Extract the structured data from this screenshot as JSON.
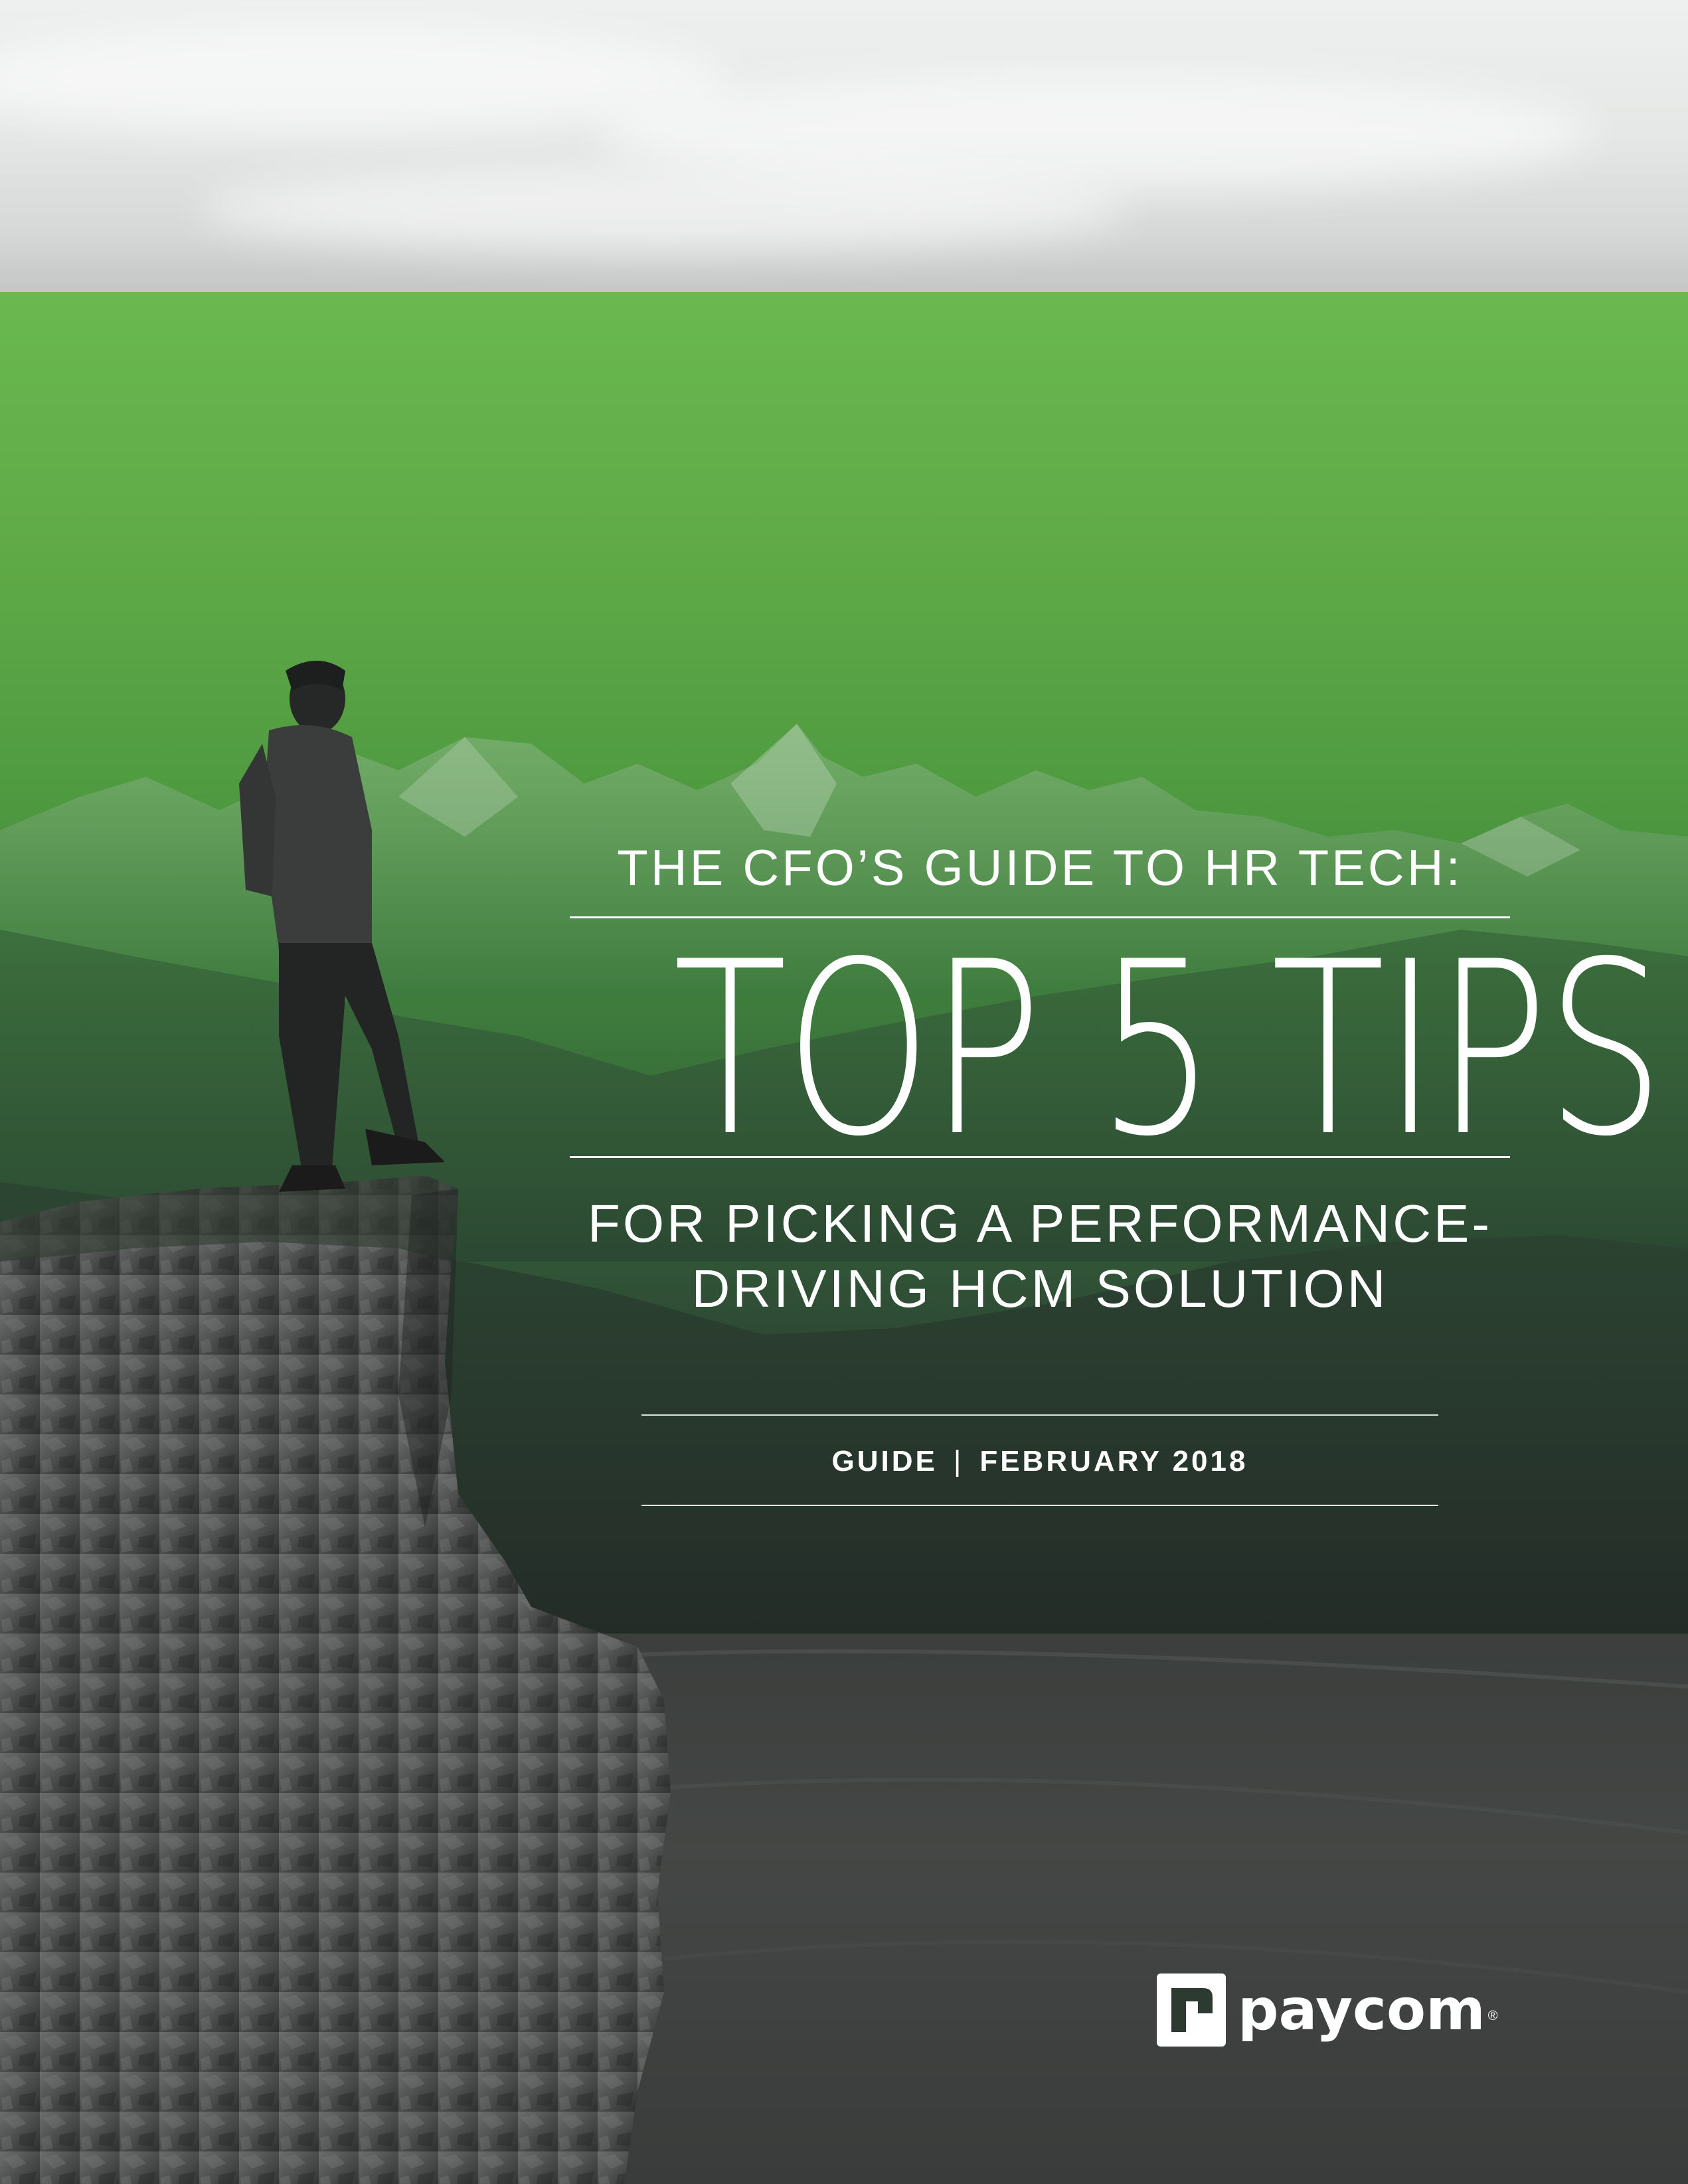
{
  "cover": {
    "pre_title": "THE CFO’S GUIDE TO HR TECH:",
    "main_title": "TOP 5 TIPS",
    "subtitle_line1": "FOR PICKING A PERFORMANCE-",
    "subtitle_line2": "DRIVING HCM SOLUTION",
    "doc_type": "GUIDE",
    "separator": "|",
    "date": "FEBRUARY 2018"
  },
  "brand": {
    "name": "paycom",
    "registered_mark": "®",
    "logo_icon": "paycom-logo-icon"
  },
  "colors": {
    "green_top": "#6ab84f",
    "green_mid": "#3f7f3c",
    "dark": "#262d2a",
    "text": "#ffffff"
  }
}
